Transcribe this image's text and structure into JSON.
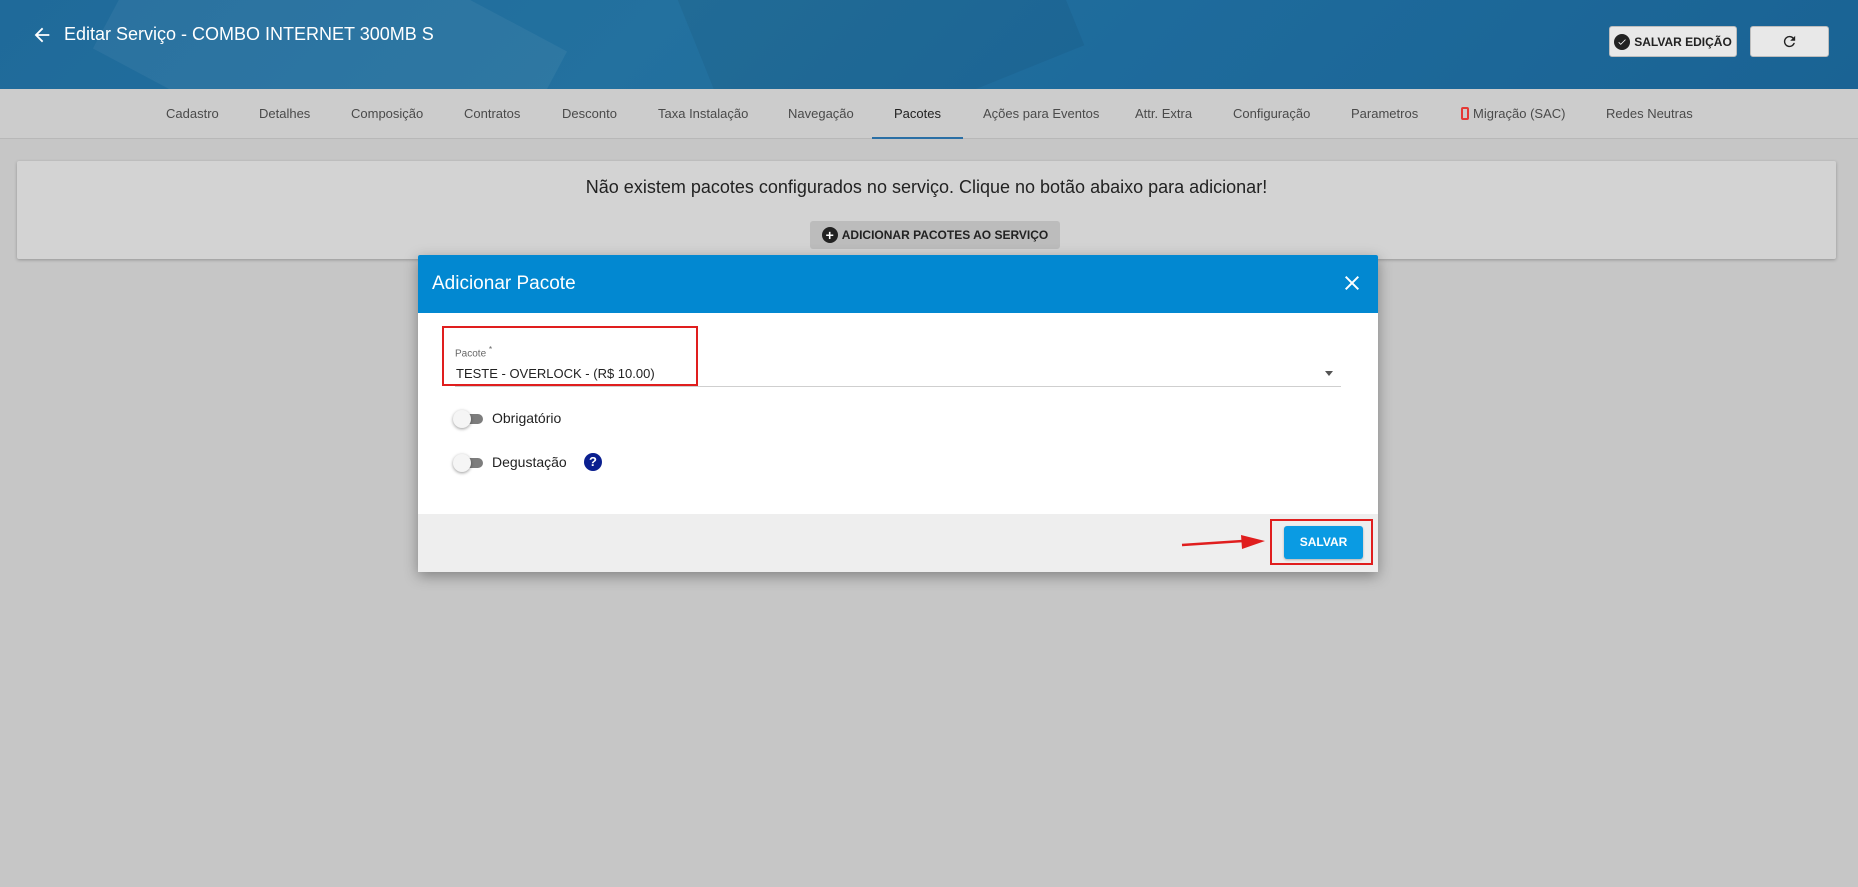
{
  "header": {
    "title": "Editar Serviço - COMBO INTERNET 300MB S",
    "back_icon": "arrow-left-icon",
    "save_edit_label": "SALVAR EDIÇÃO",
    "refresh_icon": "refresh-icon",
    "background_color": "#1f6a9a"
  },
  "tabs": [
    {
      "label": "Cadastro"
    },
    {
      "label": "Detalhes"
    },
    {
      "label": "Composição"
    },
    {
      "label": "Contratos"
    },
    {
      "label": "Desconto"
    },
    {
      "label": "Taxa Instalação"
    },
    {
      "label": "Navegação"
    },
    {
      "label": "Pacotes",
      "active": true
    },
    {
      "label": "Ações para Eventos"
    },
    {
      "label": "Attr. Extra"
    },
    {
      "label": "Configuração"
    },
    {
      "label": "Parametros"
    },
    {
      "label": "Migração (SAC)",
      "icon": "phone-icon"
    },
    {
      "label": "Redes Neutras"
    }
  ],
  "main": {
    "empty_message": "Não existem pacotes configurados no serviço. Clique no botão abaixo para adicionar!",
    "add_button_label": "ADICIONAR PACOTES AO SERVIÇO"
  },
  "modal": {
    "title": "Adicionar Pacote",
    "header_color": "#0288d1",
    "field": {
      "label": "Pacote",
      "required_mark": "*",
      "value": "TESTE - OVERLOCK - (R$ 10.00)"
    },
    "toggles": [
      {
        "label": "Obrigatório",
        "checked": false
      },
      {
        "label": "Degustação",
        "checked": false
      }
    ],
    "help_icon": "?",
    "save_label": "SALVAR",
    "accent_color": "#0a9be3",
    "highlight_color": "#e01e1e"
  }
}
